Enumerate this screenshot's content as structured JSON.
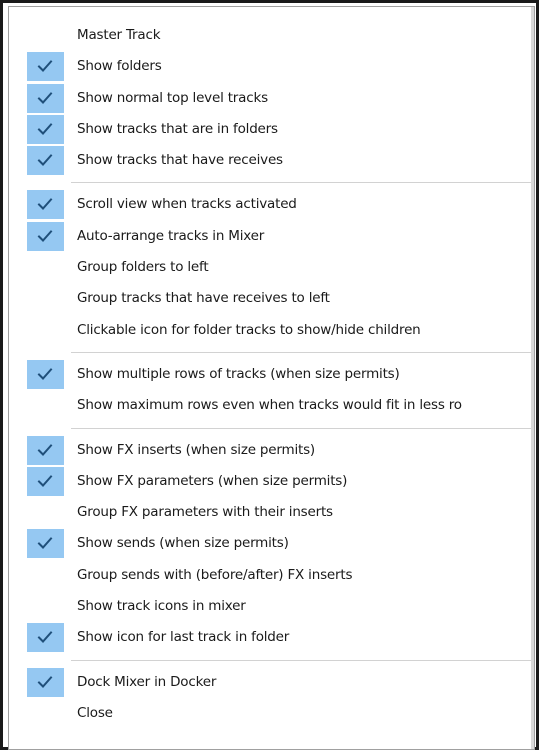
{
  "menu": {
    "groups": [
      {
        "items": [
          {
            "label": "Master Track",
            "checked": false
          },
          {
            "label": "Show folders",
            "checked": true
          },
          {
            "label": "Show normal top level tracks",
            "checked": true
          },
          {
            "label": "Show tracks that are in folders",
            "checked": true
          },
          {
            "label": "Show tracks that have receives",
            "checked": true
          }
        ]
      },
      {
        "items": [
          {
            "label": "Scroll view when tracks activated",
            "checked": true
          },
          {
            "label": "Auto-arrange tracks in Mixer",
            "checked": true
          },
          {
            "label": "Group folders to left",
            "checked": false
          },
          {
            "label": "Group tracks that have receives to left",
            "checked": false
          },
          {
            "label": "Clickable icon for folder tracks to show/hide children",
            "checked": false
          }
        ]
      },
      {
        "items": [
          {
            "label": "Show multiple rows of tracks (when size permits)",
            "checked": true
          },
          {
            "label": "Show maximum rows even when tracks would fit in less ro",
            "checked": false
          }
        ]
      },
      {
        "items": [
          {
            "label": "Show FX inserts (when size permits)",
            "checked": true
          },
          {
            "label": "Show FX parameters (when size permits)",
            "checked": true
          },
          {
            "label": "Group FX parameters with their inserts",
            "checked": false
          },
          {
            "label": "Show sends (when size permits)",
            "checked": true
          },
          {
            "label": "Group sends with (before/after) FX inserts",
            "checked": false
          },
          {
            "label": "Show track icons in mixer",
            "checked": false
          },
          {
            "label": "Show icon for last track in folder",
            "checked": true
          }
        ]
      },
      {
        "items": [
          {
            "label": "Dock Mixer in Docker",
            "checked": true
          },
          {
            "label": "Close",
            "checked": false
          }
        ]
      }
    ],
    "colors": {
      "check_highlight": "#95c8f2",
      "checkmark": "#1f4f7a",
      "text": "#1a1a1a",
      "separator": "#d2d2d2"
    },
    "icons": {
      "checkmark": "checkmark-icon"
    }
  }
}
